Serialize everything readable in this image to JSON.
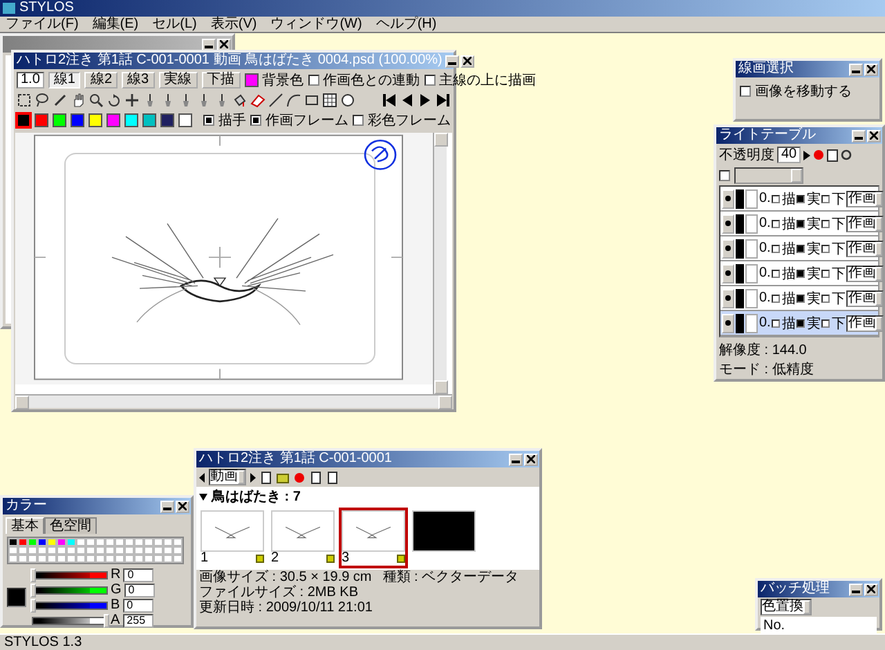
{
  "app": {
    "title": "STYLOS",
    "status": "STYLOS 1.3"
  },
  "menu": [
    "ファイル(F)",
    "編集(E)",
    "セル(L)",
    "表示(V)",
    "ウィンドウ(W)",
    "ヘルプ(H)"
  ],
  "canvas_window": {
    "title": "ハトロ2注き 第1話 C-001-0001 動画 鳥はばたき 0004.psd (100.00%)",
    "size_value": "1.0",
    "line_buttons": [
      {
        "label": "線1",
        "selected": true
      },
      {
        "label": "線2",
        "selected": false
      },
      {
        "label": "線3",
        "selected": false
      },
      {
        "label": "実線",
        "selected": false
      },
      {
        "label": "下描",
        "selected": false
      }
    ],
    "options": [
      {
        "kind": "swatch",
        "label": "背景色",
        "color": "#ff00ff"
      },
      {
        "kind": "checkbox",
        "label": "作画色との連動",
        "checked": false
      },
      {
        "kind": "checkbox",
        "label": "主線の上に描画",
        "checked": false
      }
    ],
    "palette": [
      {
        "color": "#000000",
        "selected": true
      },
      {
        "color": "#ff0000",
        "selected": false
      },
      {
        "color": "#00ff00",
        "selected": false
      },
      {
        "color": "#0000ff",
        "selected": false
      },
      {
        "color": "#ffff00",
        "selected": false
      },
      {
        "color": "#ff00ff",
        "selected": false
      },
      {
        "color": "#00ffff",
        "selected": false
      },
      {
        "color": "#00c0c0",
        "selected": false
      },
      {
        "color": "#202060",
        "selected": false
      },
      {
        "color": "#ffffff",
        "selected": false
      }
    ],
    "frame_options": [
      {
        "label": "描手",
        "checked": true
      },
      {
        "label": "作画フレーム",
        "checked": true
      },
      {
        "label": "彩色フレーム",
        "checked": false
      }
    ]
  },
  "select_panel": {
    "title": "線画選択",
    "option": {
      "label": "画像を移動する",
      "checked": false
    }
  },
  "light_table": {
    "title": "ライトテーブル",
    "opacity_label": "不透明度",
    "opacity": "40",
    "enabled": false,
    "layers": [
      {
        "number": "0.",
        "checks": [
          {
            "label": "描",
            "checked": false
          },
          {
            "label": "実",
            "checked": true
          },
          {
            "label": "下",
            "checked": false
          }
        ],
        "mode": "作画",
        "selected": false
      },
      {
        "number": "0.",
        "checks": [
          {
            "label": "描",
            "checked": false
          },
          {
            "label": "実",
            "checked": true
          },
          {
            "label": "下",
            "checked": false
          }
        ],
        "mode": "作画",
        "selected": false
      },
      {
        "number": "0.",
        "checks": [
          {
            "label": "描",
            "checked": false
          },
          {
            "label": "実",
            "checked": true
          },
          {
            "label": "下",
            "checked": false
          }
        ],
        "mode": "作画",
        "selected": false
      },
      {
        "number": "0.",
        "checks": [
          {
            "label": "描",
            "checked": false
          },
          {
            "label": "実",
            "checked": true
          },
          {
            "label": "下",
            "checked": false
          }
        ],
        "mode": "作画",
        "selected": false
      },
      {
        "number": "0.",
        "checks": [
          {
            "label": "描",
            "checked": false
          },
          {
            "label": "実",
            "checked": true
          },
          {
            "label": "下",
            "checked": false
          }
        ],
        "mode": "作画",
        "selected": false
      },
      {
        "number": "0.",
        "checks": [
          {
            "label": "描",
            "checked": false
          },
          {
            "label": "実",
            "checked": true
          },
          {
            "label": "下",
            "checked": false
          }
        ],
        "mode": "作画",
        "selected": true
      }
    ],
    "resolution": "解像度 : 144.0",
    "mode": "モード : 低精度"
  },
  "color_panel": {
    "title": "カラー",
    "tabs": [
      {
        "label": "基本",
        "selected": true
      },
      {
        "label": "色空間",
        "selected": false
      }
    ],
    "swatches": [
      {
        "color": "#000000"
      },
      {
        "color": "#ff0000"
      },
      {
        "color": "#00ff00"
      },
      {
        "color": "#0000ff"
      },
      {
        "color": "#ffff00"
      },
      {
        "color": "#ff00ff"
      },
      {
        "color": "#00ffff"
      }
    ],
    "channels": [
      {
        "name": "R",
        "value": "0",
        "level": 0,
        "color": "#ff0000"
      },
      {
        "name": "G",
        "value": "0",
        "level": 0,
        "color": "#00ff00"
      },
      {
        "name": "B",
        "value": "0",
        "level": 0,
        "color": "#0000ff"
      },
      {
        "name": "A",
        "value": "255",
        "level": 1,
        "color": "#ffffff"
      }
    ]
  },
  "timeline": {
    "title": "ハトロ2注き 第1話 C-001-0001",
    "layer": "動画",
    "section": "鳥はばたき : 7",
    "cells": [
      {
        "number": "1",
        "kind": "drawing",
        "selected": false
      },
      {
        "number": "2",
        "kind": "drawing",
        "selected": false
      },
      {
        "number": "3",
        "kind": "drawing",
        "selected": true
      },
      {
        "kind": "empty",
        "selected": false
      }
    ],
    "info": [
      "画像サイズ : 30.5 × 19.9 cm",
      "種類 : ベクターデータ",
      "ファイルサイズ : 2MB KB",
      "更新日時 : 2009/10/11 21:01"
    ]
  },
  "batch_panel": {
    "title": "バッチ処理",
    "action": "色置換",
    "column": "No."
  }
}
